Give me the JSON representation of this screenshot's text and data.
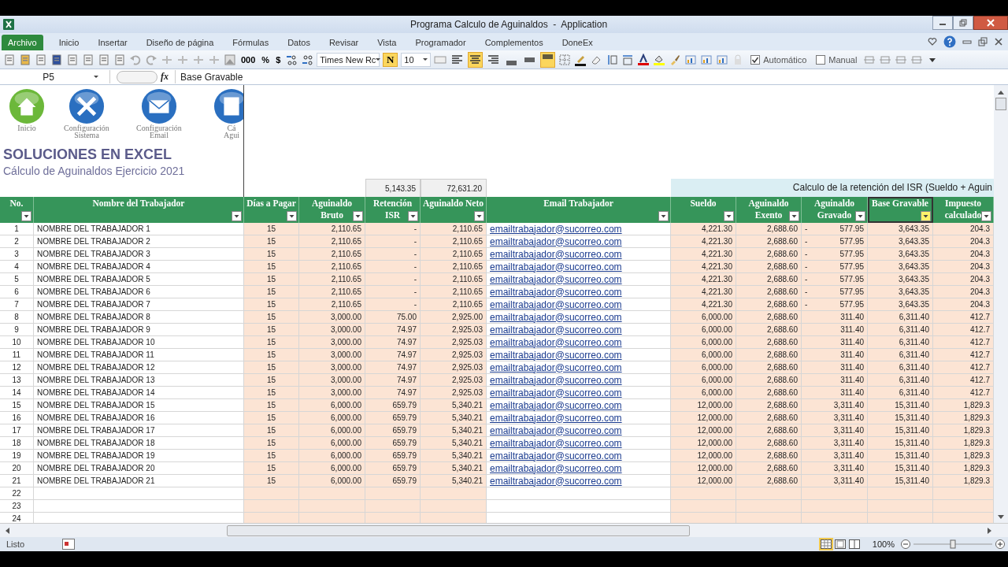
{
  "window": {
    "title": "Programa Calculo de Aguinaldos  -  Application"
  },
  "ribbon_tabs": [
    {
      "label": "Archivo",
      "selected": true
    },
    {
      "label": "Inicio",
      "selected": false
    },
    {
      "label": "Insertar",
      "selected": false
    },
    {
      "label": "Diseño de página",
      "selected": false
    },
    {
      "label": "Fórmulas",
      "selected": false
    },
    {
      "label": "Datos",
      "selected": false
    },
    {
      "label": "Revisar",
      "selected": false
    },
    {
      "label": "Vista",
      "selected": false
    },
    {
      "label": "Programador",
      "selected": false
    },
    {
      "label": "Complementos",
      "selected": false
    },
    {
      "label": "DoneEx",
      "selected": false
    }
  ],
  "toolbar": {
    "number_formats": [
      "000",
      "%",
      "$"
    ],
    "font_name": "Times New Rc",
    "bold": {
      "label": "N",
      "on": true
    },
    "font_size": "10",
    "align_buttons": [
      {
        "selected": false
      },
      {
        "selected": true
      },
      {
        "selected": false
      }
    ],
    "vertical_align_buttons": [
      {
        "selected": false
      },
      {
        "selected": false
      },
      {
        "selected": true
      }
    ],
    "calc_options": [
      {
        "label": "Automático",
        "checked": true
      },
      {
        "label": "Manual",
        "checked": false
      }
    ]
  },
  "formula_bar": {
    "name_box": "P5",
    "fx": "fx",
    "value": "Base Gravable"
  },
  "launcher": [
    {
      "kind": "house",
      "lines": [
        "Inicio"
      ]
    },
    {
      "kind": "tools",
      "lines": [
        "Configuración",
        "Sistema"
      ]
    },
    {
      "kind": "envelope",
      "lines": [
        "Configuración",
        "Email"
      ]
    },
    {
      "kind": "sheet",
      "lines": [
        "Cá",
        "Agui"
      ]
    }
  ],
  "brand": {
    "title": "SOLUCIONES EN EXCEL",
    "subtitle": "Cálculo de Aguinaldos Ejercicio 2021"
  },
  "totals": {
    "retencion": "5,143.35",
    "neto": "72,631.20"
  },
  "section_banner": "Calculo de la retención del ISR (Sueldo + Aguin",
  "columns": [
    {
      "lines": [
        "No."
      ],
      "selected": false
    },
    {
      "lines": [
        "Nombre del Trabajador"
      ],
      "selected": false
    },
    {
      "lines": [
        "Días a Pagar"
      ],
      "selected": false
    },
    {
      "lines": [
        "Aguinaldo",
        "Bruto"
      ],
      "selected": false
    },
    {
      "lines": [
        "Retención",
        "ISR"
      ],
      "selected": false
    },
    {
      "lines": [
        "Aguinaldo Neto"
      ],
      "selected": false
    },
    {
      "lines": [
        "Email Trabajador"
      ],
      "selected": false
    },
    {
      "lines": [
        "Sueldo"
      ],
      "selected": false
    },
    {
      "lines": [
        "Aguinaldo",
        "Exento"
      ],
      "selected": false
    },
    {
      "lines": [
        "Aguinaldo",
        "Gravado"
      ],
      "selected": false
    },
    {
      "lines": [
        "Base Gravable"
      ],
      "selected": true
    },
    {
      "lines": [
        "Impuesto",
        "calculado"
      ],
      "selected": false
    }
  ],
  "rows": [
    {
      "cells": [
        "1",
        "NOMBRE DEL TRABAJADOR 1",
        "15",
        "2,110.65",
        "-",
        "2,110.65",
        "emailtrabajador@sucorreo.com",
        "4,221.30",
        "2,688.60",
        "577.95",
        "3,643.35",
        "204.3"
      ],
      "sign": "-"
    },
    {
      "cells": [
        "2",
        "NOMBRE DEL TRABAJADOR 2",
        "15",
        "2,110.65",
        "-",
        "2,110.65",
        "emailtrabajador@sucorreo.com",
        "4,221.30",
        "2,688.60",
        "577.95",
        "3,643.35",
        "204.3"
      ],
      "sign": "-"
    },
    {
      "cells": [
        "3",
        "NOMBRE DEL TRABAJADOR 3",
        "15",
        "2,110.65",
        "-",
        "2,110.65",
        "emailtrabajador@sucorreo.com",
        "4,221.30",
        "2,688.60",
        "577.95",
        "3,643.35",
        "204.3"
      ],
      "sign": "-"
    },
    {
      "cells": [
        "4",
        "NOMBRE DEL TRABAJADOR 4",
        "15",
        "2,110.65",
        "-",
        "2,110.65",
        "emailtrabajador@sucorreo.com",
        "4,221.30",
        "2,688.60",
        "577.95",
        "3,643.35",
        "204.3"
      ],
      "sign": "-"
    },
    {
      "cells": [
        "5",
        "NOMBRE DEL TRABAJADOR 5",
        "15",
        "2,110.65",
        "-",
        "2,110.65",
        "emailtrabajador@sucorreo.com",
        "4,221.30",
        "2,688.60",
        "577.95",
        "3,643.35",
        "204.3"
      ],
      "sign": "-"
    },
    {
      "cells": [
        "6",
        "NOMBRE DEL TRABAJADOR 6",
        "15",
        "2,110.65",
        "-",
        "2,110.65",
        "emailtrabajador@sucorreo.com",
        "4,221.30",
        "2,688.60",
        "577.95",
        "3,643.35",
        "204.3"
      ],
      "sign": "-"
    },
    {
      "cells": [
        "7",
        "NOMBRE DEL TRABAJADOR 7",
        "15",
        "2,110.65",
        "-",
        "2,110.65",
        "emailtrabajador@sucorreo.com",
        "4,221.30",
        "2,688.60",
        "577.95",
        "3,643.35",
        "204.3"
      ],
      "sign": "-"
    },
    {
      "cells": [
        "8",
        "NOMBRE DEL TRABAJADOR 8",
        "15",
        "3,000.00",
        "75.00",
        "2,925.00",
        "emailtrabajador@sucorreo.com",
        "6,000.00",
        "2,688.60",
        "311.40",
        "6,311.40",
        "412.7"
      ]
    },
    {
      "cells": [
        "9",
        "NOMBRE DEL TRABAJADOR 9",
        "15",
        "3,000.00",
        "74.97",
        "2,925.03",
        "emailtrabajador@sucorreo.com",
        "6,000.00",
        "2,688.60",
        "311.40",
        "6,311.40",
        "412.7"
      ]
    },
    {
      "cells": [
        "10",
        "NOMBRE DEL TRABAJADOR 10",
        "15",
        "3,000.00",
        "74.97",
        "2,925.03",
        "emailtrabajador@sucorreo.com",
        "6,000.00",
        "2,688.60",
        "311.40",
        "6,311.40",
        "412.7"
      ]
    },
    {
      "cells": [
        "11",
        "NOMBRE DEL TRABAJADOR 11",
        "15",
        "3,000.00",
        "74.97",
        "2,925.03",
        "emailtrabajador@sucorreo.com",
        "6,000.00",
        "2,688.60",
        "311.40",
        "6,311.40",
        "412.7"
      ]
    },
    {
      "cells": [
        "12",
        "NOMBRE DEL TRABAJADOR 12",
        "15",
        "3,000.00",
        "74.97",
        "2,925.03",
        "emailtrabajador@sucorreo.com",
        "6,000.00",
        "2,688.60",
        "311.40",
        "6,311.40",
        "412.7"
      ]
    },
    {
      "cells": [
        "13",
        "NOMBRE DEL TRABAJADOR 13",
        "15",
        "3,000.00",
        "74.97",
        "2,925.03",
        "emailtrabajador@sucorreo.com",
        "6,000.00",
        "2,688.60",
        "311.40",
        "6,311.40",
        "412.7"
      ]
    },
    {
      "cells": [
        "14",
        "NOMBRE DEL TRABAJADOR 14",
        "15",
        "3,000.00",
        "74.97",
        "2,925.03",
        "emailtrabajador@sucorreo.com",
        "6,000.00",
        "2,688.60",
        "311.40",
        "6,311.40",
        "412.7"
      ]
    },
    {
      "cells": [
        "15",
        "NOMBRE DEL TRABAJADOR 15",
        "15",
        "6,000.00",
        "659.79",
        "5,340.21",
        "emailtrabajador@sucorreo.com",
        "12,000.00",
        "2,688.60",
        "3,311.40",
        "15,311.40",
        "1,829.3"
      ]
    },
    {
      "cells": [
        "16",
        "NOMBRE DEL TRABAJADOR 16",
        "15",
        "6,000.00",
        "659.79",
        "5,340.21",
        "emailtrabajador@sucorreo.com",
        "12,000.00",
        "2,688.60",
        "3,311.40",
        "15,311.40",
        "1,829.3"
      ]
    },
    {
      "cells": [
        "17",
        "NOMBRE DEL TRABAJADOR 17",
        "15",
        "6,000.00",
        "659.79",
        "5,340.21",
        "emailtrabajador@sucorreo.com",
        "12,000.00",
        "2,688.60",
        "3,311.40",
        "15,311.40",
        "1,829.3"
      ]
    },
    {
      "cells": [
        "18",
        "NOMBRE DEL TRABAJADOR 18",
        "15",
        "6,000.00",
        "659.79",
        "5,340.21",
        "emailtrabajador@sucorreo.com",
        "12,000.00",
        "2,688.60",
        "3,311.40",
        "15,311.40",
        "1,829.3"
      ]
    },
    {
      "cells": [
        "19",
        "NOMBRE DEL TRABAJADOR 19",
        "15",
        "6,000.00",
        "659.79",
        "5,340.21",
        "emailtrabajador@sucorreo.com",
        "12,000.00",
        "2,688.60",
        "3,311.40",
        "15,311.40",
        "1,829.3"
      ]
    },
    {
      "cells": [
        "20",
        "NOMBRE DEL TRABAJADOR 20",
        "15",
        "6,000.00",
        "659.79",
        "5,340.21",
        "emailtrabajador@sucorreo.com",
        "12,000.00",
        "2,688.60",
        "3,311.40",
        "15,311.40",
        "1,829.3"
      ]
    },
    {
      "cells": [
        "21",
        "NOMBRE DEL TRABAJADOR 21",
        "15",
        "6,000.00",
        "659.79",
        "5,340.21",
        "emailtrabajador@sucorreo.com",
        "12,000.00",
        "2,688.60",
        "3,311.40",
        "15,311.40",
        "1,829.3"
      ]
    },
    {
      "cells": [
        "22"
      ]
    },
    {
      "cells": [
        "23"
      ]
    },
    {
      "cells": [
        "24"
      ]
    }
  ],
  "status_bar": {
    "status": "Listo",
    "zoom": "100%",
    "level": 0.5
  }
}
